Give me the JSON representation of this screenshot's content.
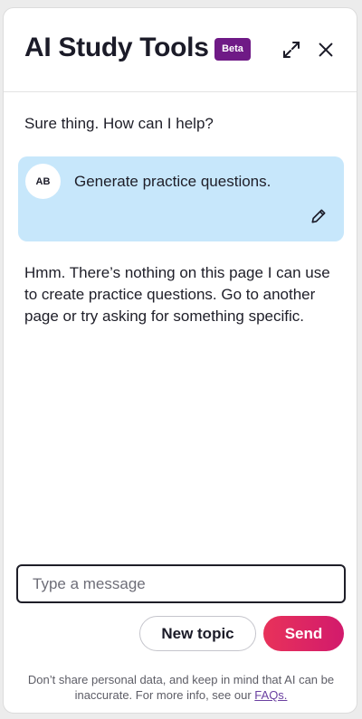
{
  "header": {
    "title": "AI Study Tools",
    "badge": "Beta",
    "expand_icon": "expand-icon",
    "close_icon": "close-icon"
  },
  "conversation": {
    "greeting": "Sure thing. How can I help?",
    "user_message": {
      "avatar_initials": "AB",
      "text": "Generate practice questions.",
      "edit_icon": "pencil-icon"
    },
    "response": "Hmm. There’s nothing on this page I can use to create practice questions. Go to another page or try asking for something specific."
  },
  "composer": {
    "placeholder": "Type a message",
    "value": "",
    "new_topic_label": "New topic",
    "send_label": "Send"
  },
  "footer": {
    "disclaimer": "Don’t share personal data, and keep in mind that AI can be inaccurate. For more info, see our",
    "faq_link": "FAQs."
  },
  "colors": {
    "beta_badge": "#6f1a86",
    "user_bubble": "#c7e7fb",
    "send_gradient_start": "#e8325a",
    "send_gradient_end": "#d21a6c",
    "link": "#6a3fa0"
  }
}
